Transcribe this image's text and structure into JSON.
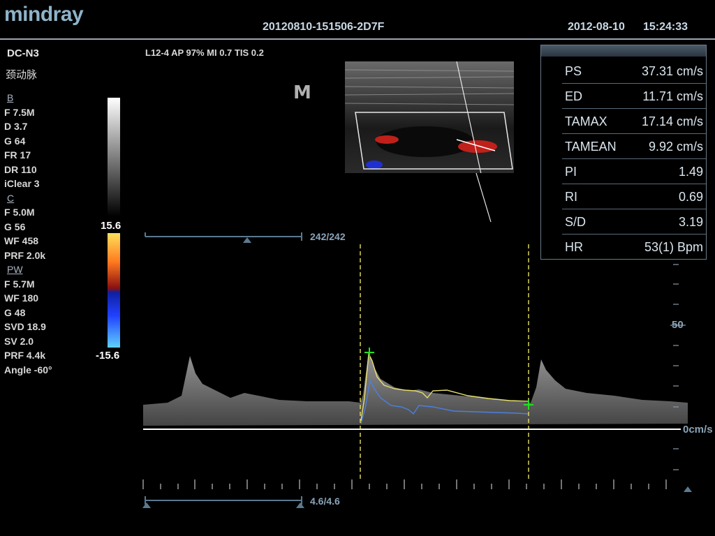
{
  "header": {
    "brand": "mindray",
    "exam_id": "20120810-151506-2D7F",
    "date": "2012-08-10",
    "time": "15:24:33"
  },
  "probe": {
    "name": "DC-N3",
    "organ": "颈动脉"
  },
  "acquisition": "L12-4  AP 97%  MI 0.7  TIS 0.2",
  "params": {
    "b_label": "B",
    "b": [
      "F 7.5M",
      "D 3.7",
      "G 64",
      "FR 17",
      "DR 110",
      "iClear 3"
    ],
    "c_label": "C",
    "c": [
      "F 5.0M",
      "G 56",
      "WF 458",
      "PRF 2.0k"
    ],
    "pw_label": "PW",
    "pw": [
      "F 5.7M",
      "WF 180",
      "G 48",
      "SVD 18.9",
      "SV 2.0",
      "PRF 4.4k",
      "Angle -60°"
    ]
  },
  "m_logo": "M",
  "colorbar": {
    "top": "15.6",
    "bottom": "-15.6"
  },
  "measurements": [
    {
      "label": "PS",
      "value": "37.31 cm/s"
    },
    {
      "label": "ED",
      "value": "11.71 cm/s"
    },
    {
      "label": "TAMAX",
      "value": "17.14 cm/s"
    },
    {
      "label": "TAMEAN",
      "value": "9.92 cm/s"
    },
    {
      "label": "PI",
      "value": "1.49"
    },
    {
      "label": "RI",
      "value": "0.69"
    },
    {
      "label": "S/D",
      "value": "3.19"
    },
    {
      "label": "HR",
      "value": "53(1) Bpm"
    }
  ],
  "cine_top": "242/242",
  "cine_bottom": "4.6/4.6",
  "velocity_scale": {
    "label_50": "50",
    "label_0": "0cm/s"
  },
  "colors": {
    "accent": "#8aa4b8",
    "trace_max": "#e8e070",
    "trace_mean": "#4a80e0",
    "caliper": "#22e022",
    "marker": "#e8e060"
  }
}
